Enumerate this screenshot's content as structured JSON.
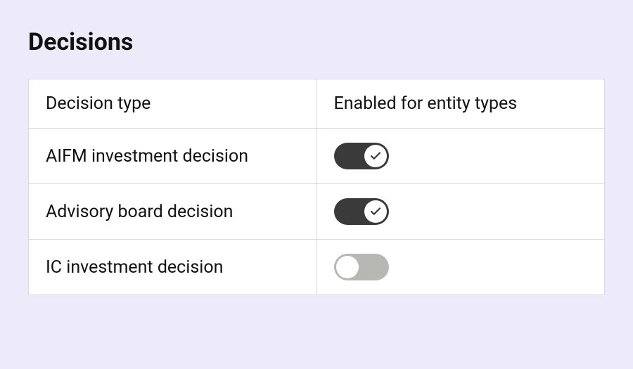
{
  "title": "Decisions",
  "table": {
    "headers": {
      "col1": "Decision type",
      "col2": "Enabled for entity types"
    },
    "rows": [
      {
        "label": "AIFM investment decision",
        "enabled": true
      },
      {
        "label": "Advisory board decision",
        "enabled": true
      },
      {
        "label": "IC investment decision",
        "enabled": false
      }
    ]
  }
}
